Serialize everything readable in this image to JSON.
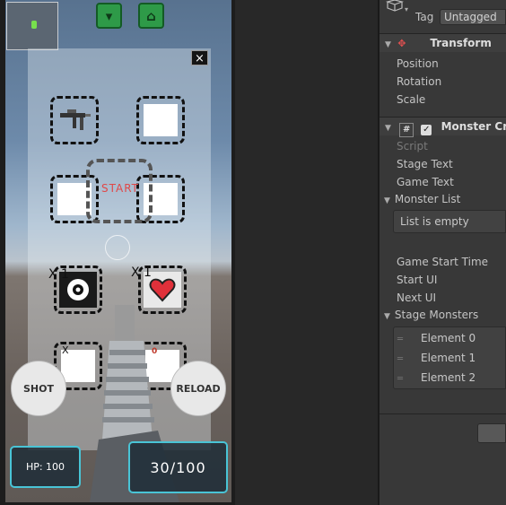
{
  "game": {
    "start_label": "START",
    "shot_label": "SHOT",
    "reload_label": "RELOAD",
    "hp_text": "HP: 100",
    "ammo_text": "30/100",
    "close_label": "×",
    "slots": [
      {
        "count": "",
        "mark": ""
      },
      {
        "count": "",
        "mark": ""
      },
      {
        "count": "",
        "mark": ""
      },
      {
        "count": "",
        "mark": ""
      },
      {
        "count": "X 1",
        "mark": ""
      },
      {
        "count": "X 1",
        "mark": ""
      },
      {
        "count": "",
        "mark": "X"
      },
      {
        "count": "",
        "mark": "0"
      }
    ]
  },
  "inspector": {
    "tag_label": "Tag",
    "tag_value": "Untagged",
    "transform": {
      "title": "Transform",
      "fields": [
        "Position",
        "Rotation",
        "Scale"
      ]
    },
    "component": {
      "title": "Monster Crea",
      "script_label": "Script",
      "stage_text": "Stage Text",
      "game_text": "Game Text",
      "monster_list": "Monster List",
      "list_empty": "List is empty",
      "game_start_time": "Game Start Time",
      "start_ui": "Start UI",
      "next_ui": "Next UI",
      "stage_monsters": "Stage Monsters",
      "elements": [
        "Element 0",
        "Element 1",
        "Element 2"
      ]
    }
  },
  "colors": {
    "accent_hud": "#49c4d6",
    "start_text": "#e04848",
    "inspector_bg": "#383838"
  }
}
